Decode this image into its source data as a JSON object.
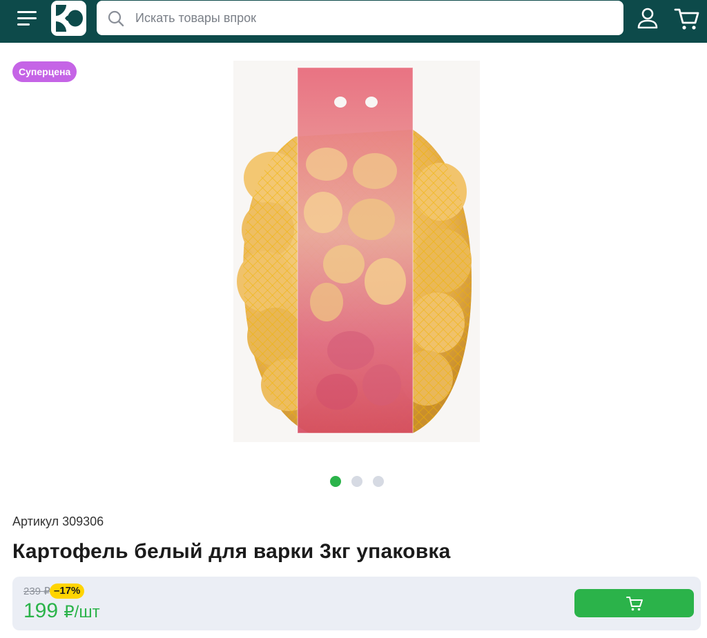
{
  "header": {
    "search_placeholder": "Искать товары впрок",
    "icons": {
      "menu": "hamburger-icon",
      "logo": "store-logo",
      "search": "search-icon",
      "user": "user-icon",
      "cart": "cart-icon"
    },
    "colors": {
      "background": "#0d4a4a",
      "accent": "#2bb34a"
    }
  },
  "product": {
    "badge": "Суперцена",
    "image_alt": "Картофель белый для варки 3кг упаковка",
    "gallery": {
      "count": 3,
      "active_index": 0
    },
    "article": "Артикул 309306",
    "title": "Картофель белый для варки 3кг упаковка"
  },
  "pricing": {
    "old_price": "239 ₽",
    "discount": "–17%",
    "price_value": "199",
    "price_unit": "₽/шт",
    "add_to_cart_icon": "cart-icon"
  }
}
